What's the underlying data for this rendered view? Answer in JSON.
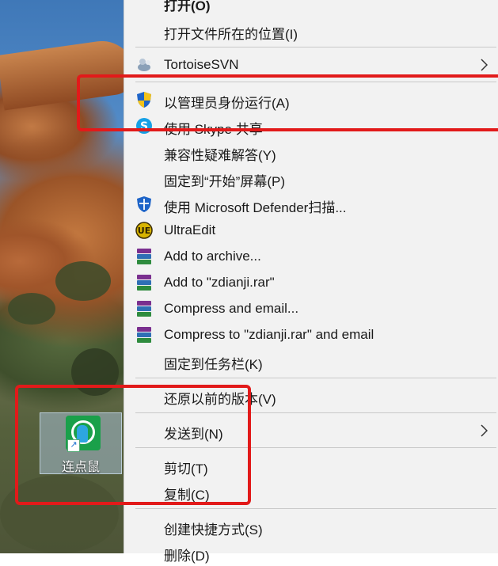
{
  "desktop_icon": {
    "label": "连点鼠"
  },
  "menu": {
    "items": [
      {
        "label": "打开(O)"
      },
      {
        "label": "打开文件所在的位置(I)"
      },
      {
        "label": "TortoiseSVN"
      },
      {
        "label": "以管理员身份运行(A)"
      },
      {
        "label": "使用 Skype 共享"
      },
      {
        "label": "兼容性疑难解答(Y)"
      },
      {
        "label": "固定到“开始”屏幕(P)"
      },
      {
        "label": "使用 Microsoft Defender扫描..."
      },
      {
        "label": "UltraEdit"
      },
      {
        "label": "Add to archive..."
      },
      {
        "label": "Add to \"zdianji.rar\""
      },
      {
        "label": "Compress and email..."
      },
      {
        "label": "Compress to \"zdianji.rar\" and email"
      },
      {
        "label": "固定到任务栏(K)"
      },
      {
        "label": "还原以前的版本(V)"
      },
      {
        "label": "发送到(N)"
      },
      {
        "label": "剪切(T)"
      },
      {
        "label": "复制(C)"
      },
      {
        "label": "创建快捷方式(S)"
      },
      {
        "label": "删除(D)"
      }
    ]
  },
  "colors": {
    "highlight_box": "#e21a1a",
    "menu_bg": "#f2f2f2"
  }
}
